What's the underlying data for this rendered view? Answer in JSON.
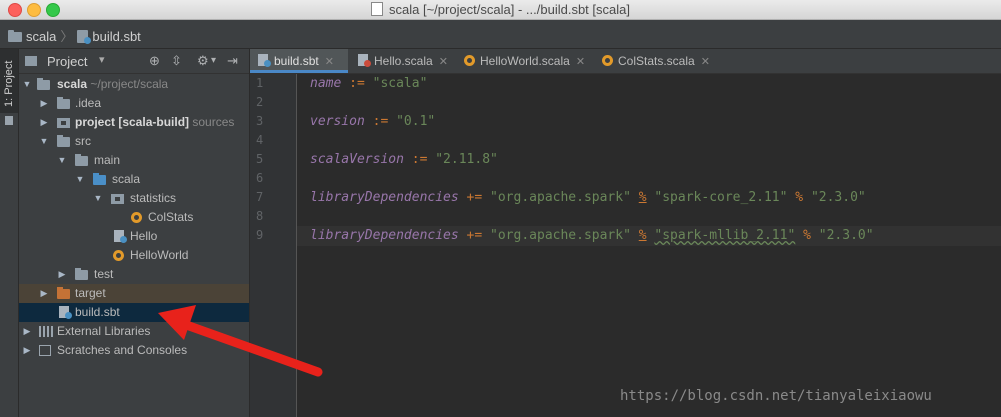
{
  "window": {
    "title": "scala [~/project/scala] - .../build.sbt [scala]"
  },
  "breadcrumb": {
    "project": "scala",
    "file": "build.sbt"
  },
  "stripe": {
    "label": "1: Project"
  },
  "project_panel": {
    "title": "Project",
    "tree": [
      {
        "name": "scala",
        "suffix": "~/project/scala",
        "icon": "folder-icon",
        "bold": true
      },
      {
        "name": ".idea",
        "icon": "folder-icon"
      },
      {
        "name": "project [scala-build]",
        "suffix": "sources",
        "icon": "package-folder-icon",
        "bold": true
      },
      {
        "name": "src",
        "icon": "folder-icon"
      },
      {
        "name": "main",
        "icon": "folder-icon"
      },
      {
        "name": "scala",
        "icon": "source-folder-icon"
      },
      {
        "name": "statistics",
        "icon": "package-icon"
      },
      {
        "name": "ColStats",
        "icon": "scala-object-icon"
      },
      {
        "name": "Hello",
        "icon": "scala-file-icon"
      },
      {
        "name": "HelloWorld",
        "icon": "scala-object-icon"
      },
      {
        "name": "test",
        "icon": "folder-icon"
      },
      {
        "name": "target",
        "icon": "excluded-folder-icon"
      },
      {
        "name": "build.sbt",
        "icon": "sbt-file-icon"
      },
      {
        "name": "External Libraries",
        "icon": "libraries-icon"
      },
      {
        "name": "Scratches and Consoles",
        "icon": "scratches-icon"
      }
    ]
  },
  "tabs": [
    {
      "label": "build.sbt",
      "icon": "sbt-file-icon",
      "active": true
    },
    {
      "label": "Hello.scala",
      "icon": "scala-file-icon"
    },
    {
      "label": "HelloWorld.scala",
      "icon": "scala-object-icon"
    },
    {
      "label": "ColStats.scala",
      "icon": "scala-object-icon"
    }
  ],
  "editor": {
    "line_numbers": [
      "1",
      "2",
      "3",
      "4",
      "5",
      "6",
      "7",
      "8",
      "9"
    ],
    "lines": {
      "l1": {
        "key": "name",
        "op": ":=",
        "val": "\"scala\""
      },
      "l3": {
        "key": "version",
        "op": ":=",
        "val": "\"0.1\""
      },
      "l5": {
        "key": "scalaVersion",
        "op": ":=",
        "val": "\"2.11.8\""
      },
      "l7": {
        "key": "libraryDependencies",
        "op": "+=",
        "org": "\"org.apache.spark\"",
        "pct": "%",
        "art": "\"spark-core_2.11\"",
        "pct2": "%",
        "ver": "\"2.3.0\""
      },
      "l9": {
        "key": "libraryDependencies",
        "op": "+=",
        "org": "\"org.apache.spark\"",
        "pct": "%",
        "art": "\"spark-mllib_2.11\"",
        "pct2": "%",
        "ver": "\"2.3.0\""
      }
    }
  },
  "watermark": "https://blog.csdn.net/tianyaleixiaowu",
  "colors": {
    "accent": "#4a88c7",
    "arrow": "#e8221b",
    "selection": "#0d293e"
  }
}
